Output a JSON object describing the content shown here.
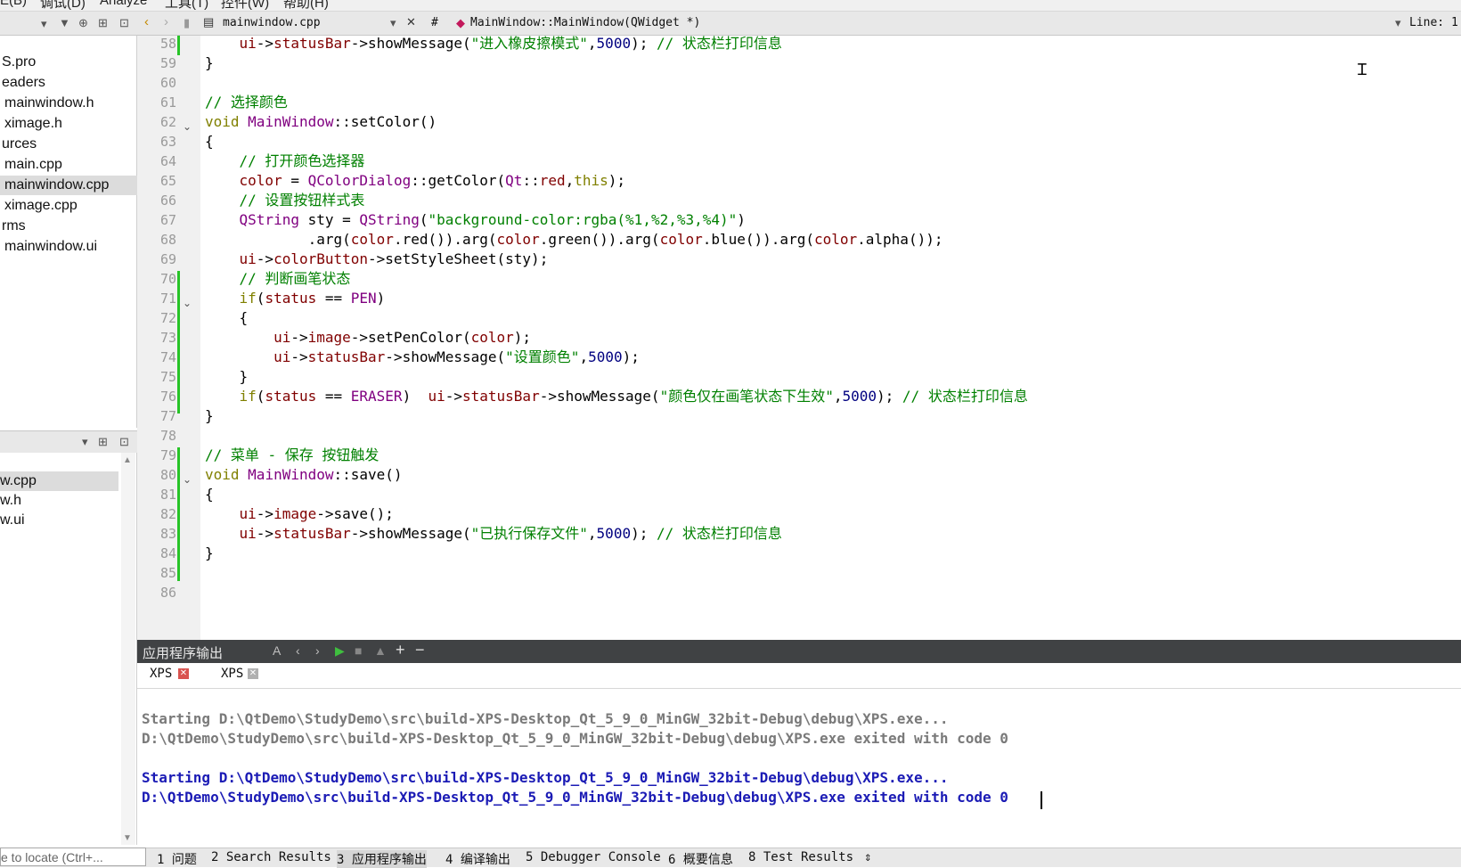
{
  "menubar": {
    "items": [
      "E(B)",
      "调试(D)",
      "Analyze",
      "工具(T)",
      "控件(W)",
      "帮助(H)"
    ]
  },
  "project_tree": {
    "items": [
      {
        "label": "S.pro",
        "indent": 0
      },
      {
        "label": "eaders",
        "indent": 0
      },
      {
        "label": "mainwindow.h",
        "indent": 1
      },
      {
        "label": "ximage.h",
        "indent": 1
      },
      {
        "label": "urces",
        "indent": 0
      },
      {
        "label": "main.cpp",
        "indent": 1
      },
      {
        "label": "mainwindow.cpp",
        "indent": 1,
        "selected": true
      },
      {
        "label": "ximage.cpp",
        "indent": 1
      },
      {
        "label": "rms",
        "indent": 0
      },
      {
        "label": "mainwindow.ui",
        "indent": 1
      }
    ]
  },
  "open_documents": {
    "items": [
      {
        "label": "w.cpp",
        "selected": true
      },
      {
        "label": "w.h"
      },
      {
        "label": "w.ui"
      }
    ]
  },
  "editor_toolbar": {
    "file_name": "mainwindow.cpp",
    "hash": "#",
    "symbol": "MainWindow::MainWindow(QWidget *)",
    "line_label": "Line: 1"
  },
  "code": {
    "line_numbers": [
      "58",
      "59",
      "60",
      "61",
      "62",
      "63",
      "64",
      "65",
      "66",
      "67",
      "68",
      "69",
      "70",
      "71",
      "72",
      "73",
      "74",
      "75",
      "76",
      "77",
      "78",
      "79",
      "80",
      "81",
      "82",
      "83",
      "84",
      "85",
      "86"
    ]
  },
  "output": {
    "title": "应用程序输出",
    "tabs": [
      {
        "label": "XPS"
      },
      {
        "label": "XPS"
      }
    ],
    "lines": [
      {
        "text": "Starting D:\\QtDemo\\StudyDemo\\src\\build-XPS-Desktop_Qt_5_9_0_MinGW_32bit-Debug\\debug\\XPS.exe...",
        "style": "gray"
      },
      {
        "text": "D:\\QtDemo\\StudyDemo\\src\\build-XPS-Desktop_Qt_5_9_0_MinGW_32bit-Debug\\debug\\XPS.exe exited with code 0",
        "style": "gray"
      },
      {
        "text": "",
        "style": "gray"
      },
      {
        "text": "Starting D:\\QtDemo\\StudyDemo\\src\\build-XPS-Desktop_Qt_5_9_0_MinGW_32bit-Debug\\debug\\XPS.exe...",
        "style": "blue"
      },
      {
        "text": "D:\\QtDemo\\StudyDemo\\src\\build-XPS-Desktop_Qt_5_9_0_MinGW_32bit-Debug\\debug\\XPS.exe exited with code 0",
        "style": "blue"
      }
    ]
  },
  "bottombar": {
    "locator_placeholder": "e to locate (Ctrl+...",
    "tabs": [
      "1 问题",
      "2 Search Results",
      "3 应用程序输出",
      "4 编译输出",
      "5 Debugger Console",
      "6 概要信息",
      "8 Test Results"
    ],
    "active_index": 2
  }
}
